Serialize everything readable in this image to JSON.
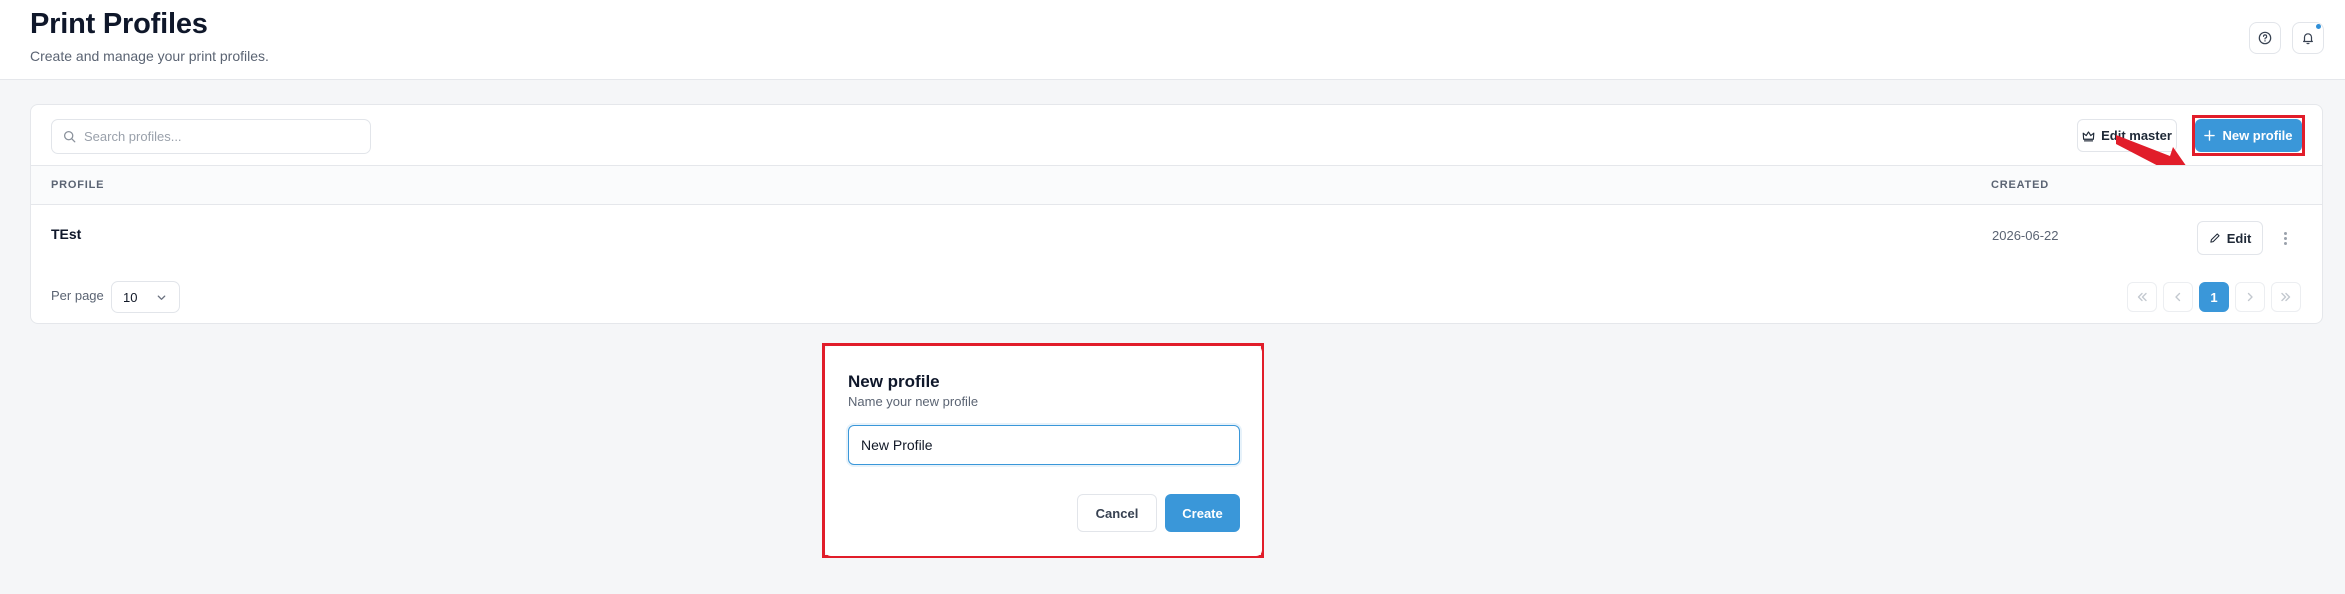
{
  "header": {
    "title": "Print Profiles",
    "subtitle": "Create and manage your print profiles.",
    "help_icon": "help-circle-icon",
    "notification_icon": "bell-icon",
    "notification_dot_color": "#2f8fd8"
  },
  "toolbar": {
    "search_placeholder": "Search profiles...",
    "search_value": "",
    "edit_master_label": "Edit master",
    "new_profile_label": "New profile",
    "accent_color": "#3a97d9",
    "annotation_color": "#e11d2a"
  },
  "table": {
    "columns": [
      "PROFILE",
      "CREATED"
    ],
    "rows": [
      {
        "profile": "TEst",
        "created": "2026-06-22",
        "edit_label": "Edit"
      }
    ]
  },
  "pagination": {
    "per_page_label": "Per page",
    "per_page_value": "10",
    "current_page": "1"
  },
  "dialog": {
    "title": "New profile",
    "subtitle": "Name your new profile",
    "input_value": "New Profile",
    "cancel_label": "Cancel",
    "create_label": "Create"
  }
}
